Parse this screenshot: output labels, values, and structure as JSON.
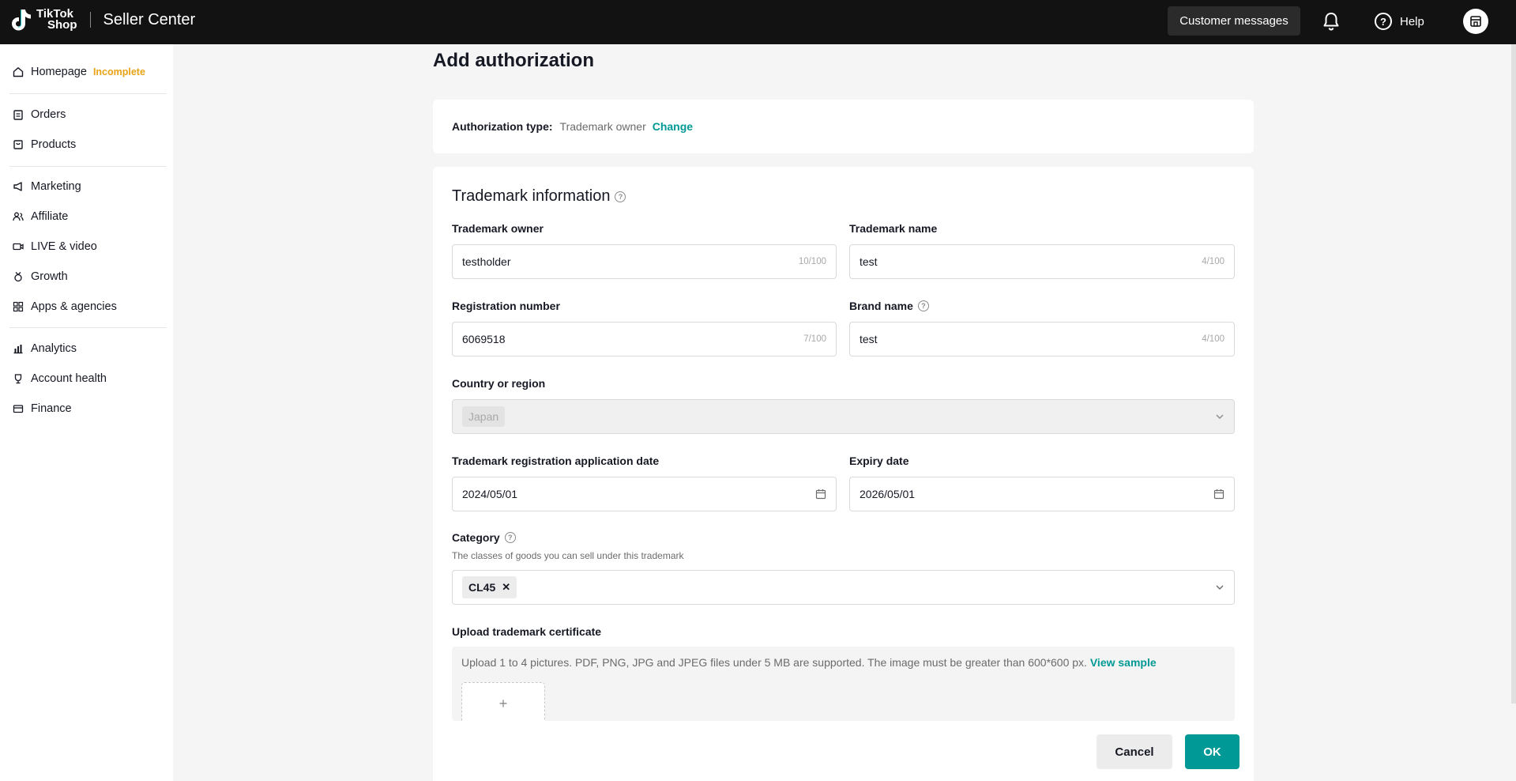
{
  "header": {
    "logo_line1": "TikTok",
    "logo_line2": "Shop",
    "app_title": "Seller Center",
    "customer_messages": "Customer messages",
    "help": "Help"
  },
  "sidebar": {
    "items": [
      {
        "label": "Homepage",
        "badge": "Incomplete",
        "icon": "home-icon"
      },
      {
        "label": "Orders",
        "icon": "clipboard-icon"
      },
      {
        "label": "Products",
        "icon": "bag-icon"
      },
      {
        "label": "Marketing",
        "icon": "megaphone-icon"
      },
      {
        "label": "Affiliate",
        "icon": "people-icon"
      },
      {
        "label": "LIVE & video",
        "icon": "video-icon"
      },
      {
        "label": "Growth",
        "icon": "medal-icon"
      },
      {
        "label": "Apps & agencies",
        "icon": "apps-icon"
      },
      {
        "label": "Analytics",
        "icon": "chart-icon"
      },
      {
        "label": "Account health",
        "icon": "trophy-icon"
      },
      {
        "label": "Finance",
        "icon": "wallet-icon"
      }
    ]
  },
  "page": {
    "title": "Add authorization"
  },
  "authorization": {
    "label": "Authorization type:",
    "value": "Trademark owner",
    "change": "Change"
  },
  "trademark": {
    "section_title": "Trademark information",
    "owner": {
      "label": "Trademark owner",
      "value": "testholder",
      "count": "10/100"
    },
    "name": {
      "label": "Trademark name",
      "value": "test",
      "count": "4/100"
    },
    "registration": {
      "label": "Registration number",
      "value": "6069518",
      "count": "7/100"
    },
    "brand": {
      "label": "Brand name",
      "value": "test",
      "count": "4/100"
    },
    "country": {
      "label": "Country or region",
      "value": "Japan"
    },
    "app_date": {
      "label": "Trademark registration application date",
      "value": "2024/05/01"
    },
    "expiry": {
      "label": "Expiry date",
      "value": "2026/05/01"
    },
    "category": {
      "label": "Category",
      "hint": "The classes of goods you can sell under this trademark",
      "tag": "CL45"
    },
    "upload": {
      "label": "Upload trademark certificate",
      "text": "Upload 1 to 4 pictures. PDF, PNG, JPG and JPEG files under 5 MB are supported. The image must be greater than 600*600 px.",
      "link": "View sample"
    }
  },
  "footer": {
    "cancel": "Cancel",
    "ok": "OK"
  },
  "colors": {
    "accent": "#009995",
    "badge": "#e8a317",
    "topbar": "#121212"
  }
}
